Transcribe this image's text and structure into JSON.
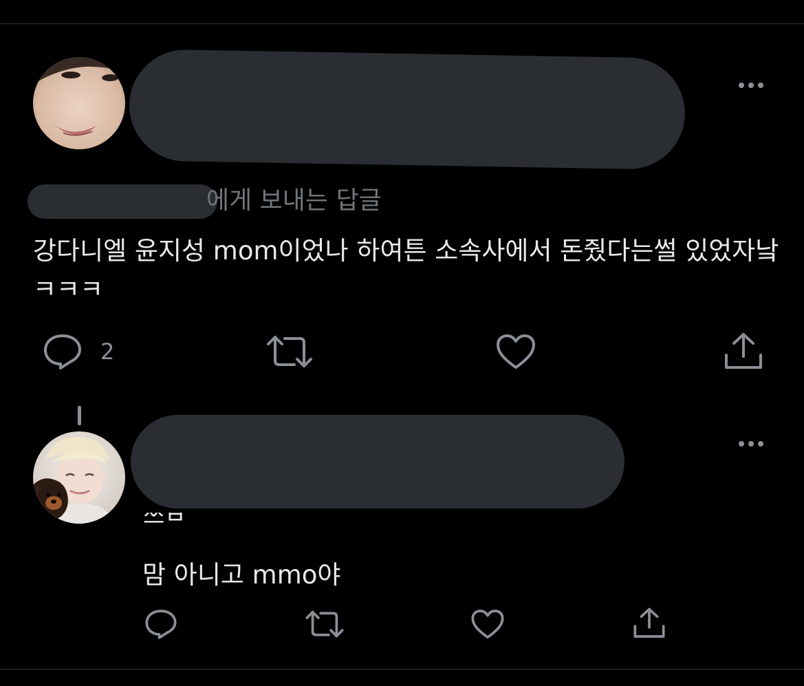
{
  "tweet1": {
    "reply_to_suffix": "에게 보내는 답글",
    "text": "강다니엘 윤지성 mom이었나 하여튼 소속사에서 돈줬다는썰 있었자낰ㅋㅋㅋ",
    "actions": {
      "reply_count": "2"
    },
    "icons": {
      "reply": "comment-icon",
      "retweet": "retweet-icon",
      "like": "heart-icon",
      "share": "share-icon",
      "more": "more-options-icon"
    }
  },
  "tweet2": {
    "handle_partial": "쓰ㅂ",
    "text": "맘 아니고 mmo야",
    "icons": {
      "reply": "comment-icon",
      "retweet": "retweet-icon",
      "like": "heart-icon",
      "share": "share-icon",
      "more": "more-options-icon"
    }
  },
  "colors": {
    "background": "#000000",
    "text": "#e7e9ea",
    "secondary": "#71767b",
    "icon": "#8b9096",
    "redaction": "#2a2d31",
    "divider": "#2f3336"
  }
}
